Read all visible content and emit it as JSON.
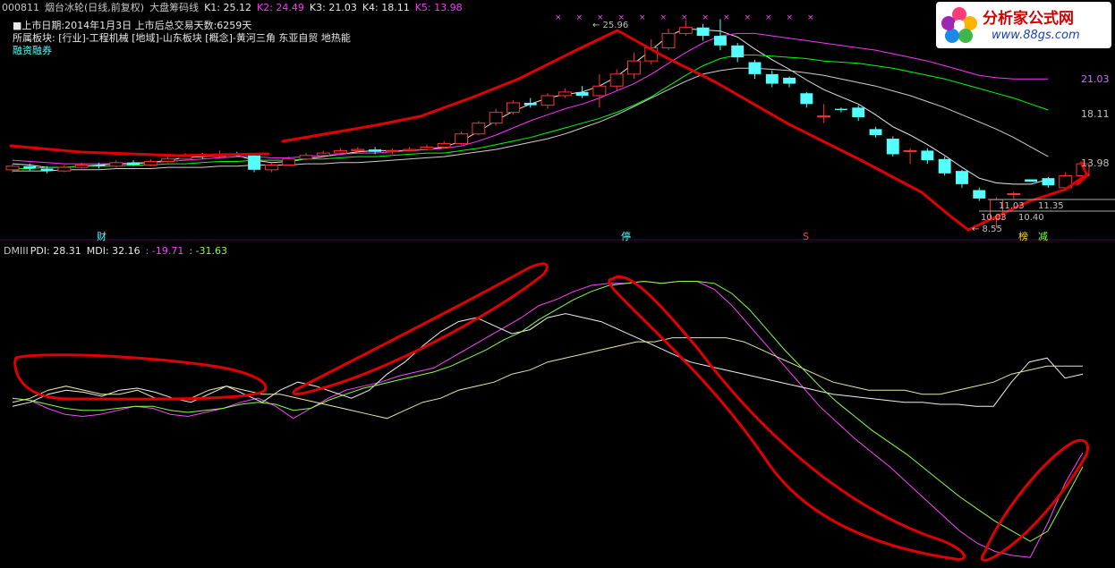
{
  "header": {
    "code": "000811",
    "name": "烟台冰轮(日线,前复权)",
    "indicator": "大盘筹码线",
    "k": [
      {
        "label": "K1: 25.12",
        "color": "#e8e8e8"
      },
      {
        "label": "K2: 24.49",
        "color": "#ff33ff"
      },
      {
        "label": "K3: 21.03",
        "color": "#e8e8e8"
      },
      {
        "label": "K4: 18.11",
        "color": "#e8e8e8"
      },
      {
        "label": "K5: 13.98",
        "color": "#ff33ff"
      }
    ],
    "list_date": "■上市日期:2014年1月3日 上市后总交易天数:6259天",
    "sectors": "所属板块: [行业]-工程机械 [地域]-山东板块 [概念]-黄河三角 东亚自贸 地热能",
    "margin": "融资融券"
  },
  "dmi_header": {
    "name": "DMIII",
    "pdi": "PDI: 28.31",
    "mdi": "MDI: 32.16",
    "v3": ": -19.71",
    "v4": ": -31.63"
  },
  "logo": {
    "title": "分析家公式网",
    "url": "www.88gs.com"
  },
  "colors": {
    "up": "#ff3232",
    "down": "#54ffff",
    "bg": "#000000",
    "annotation": "#e00000"
  },
  "chart_data": [
    {
      "type": "candlestick",
      "title": "烟台冰轮(日线,前复权)",
      "n_bars": 60,
      "candles": [
        {
          "o": 13.4,
          "c": 13.7,
          "h": 13.9,
          "l": 13.2
        },
        {
          "o": 13.7,
          "c": 13.5,
          "h": 13.9,
          "l": 13.3
        },
        {
          "o": 13.5,
          "c": 13.3,
          "h": 13.7,
          "l": 13.1
        },
        {
          "o": 13.3,
          "c": 13.6,
          "h": 13.8,
          "l": 13.2
        },
        {
          "o": 13.6,
          "c": 13.8,
          "h": 14.0,
          "l": 13.5
        },
        {
          "o": 13.8,
          "c": 13.7,
          "h": 14.0,
          "l": 13.5
        },
        {
          "o": 13.7,
          "c": 14.0,
          "h": 14.2,
          "l": 13.6
        },
        {
          "o": 14.0,
          "c": 13.8,
          "h": 14.2,
          "l": 13.7
        },
        {
          "o": 13.8,
          "c": 14.1,
          "h": 14.3,
          "l": 13.7
        },
        {
          "o": 14.1,
          "c": 14.3,
          "h": 14.5,
          "l": 14.0
        },
        {
          "o": 14.3,
          "c": 14.6,
          "h": 14.8,
          "l": 14.2
        },
        {
          "o": 14.6,
          "c": 14.5,
          "h": 14.8,
          "l": 14.3
        },
        {
          "o": 14.5,
          "c": 14.7,
          "h": 15.0,
          "l": 14.4
        },
        {
          "o": 14.7,
          "c": 14.6,
          "h": 14.9,
          "l": 14.5
        },
        {
          "o": 14.6,
          "c": 13.4,
          "h": 14.7,
          "l": 13.2
        },
        {
          "o": 13.4,
          "c": 13.8,
          "h": 14.0,
          "l": 13.2
        },
        {
          "o": 13.8,
          "c": 14.3,
          "h": 14.5,
          "l": 13.7
        },
        {
          "o": 14.3,
          "c": 14.6,
          "h": 14.8,
          "l": 14.2
        },
        {
          "o": 14.6,
          "c": 14.8,
          "h": 15.0,
          "l": 14.5
        },
        {
          "o": 14.8,
          "c": 15.0,
          "h": 15.2,
          "l": 14.6
        },
        {
          "o": 15.0,
          "c": 15.1,
          "h": 15.3,
          "l": 14.8
        },
        {
          "o": 15.1,
          "c": 14.9,
          "h": 15.3,
          "l": 14.7
        },
        {
          "o": 14.9,
          "c": 15.0,
          "h": 15.2,
          "l": 14.7
        },
        {
          "o": 15.0,
          "c": 15.1,
          "h": 15.3,
          "l": 14.9
        },
        {
          "o": 15.1,
          "c": 15.3,
          "h": 15.5,
          "l": 15.0
        },
        {
          "o": 15.3,
          "c": 15.6,
          "h": 15.8,
          "l": 15.2
        },
        {
          "o": 15.6,
          "c": 16.4,
          "h": 16.6,
          "l": 15.5
        },
        {
          "o": 16.4,
          "c": 17.3,
          "h": 17.5,
          "l": 16.3
        },
        {
          "o": 17.3,
          "c": 18.2,
          "h": 18.5,
          "l": 17.1
        },
        {
          "o": 18.2,
          "c": 19.0,
          "h": 19.2,
          "l": 18.0
        },
        {
          "o": 19.0,
          "c": 18.8,
          "h": 19.4,
          "l": 18.6
        },
        {
          "o": 18.8,
          "c": 19.6,
          "h": 19.8,
          "l": 18.5
        },
        {
          "o": 19.6,
          "c": 19.9,
          "h": 20.2,
          "l": 19.4
        },
        {
          "o": 19.9,
          "c": 19.6,
          "h": 20.4,
          "l": 19.4
        },
        {
          "o": 19.6,
          "c": 20.4,
          "h": 21.4,
          "l": 18.6
        },
        {
          "o": 20.4,
          "c": 21.4,
          "h": 21.8,
          "l": 20.0
        },
        {
          "o": 21.4,
          "c": 22.5,
          "h": 23.2,
          "l": 21.0
        },
        {
          "o": 22.5,
          "c": 23.6,
          "h": 24.3,
          "l": 22.2
        },
        {
          "o": 23.6,
          "c": 24.8,
          "h": 25.2,
          "l": 23.4
        },
        {
          "o": 24.8,
          "c": 25.3,
          "h": 25.9,
          "l": 24.6
        },
        {
          "o": 25.3,
          "c": 24.6,
          "h": 25.6,
          "l": 24.2
        },
        {
          "o": 24.6,
          "c": 23.8,
          "h": 26.0,
          "l": 23.4
        },
        {
          "o": 23.8,
          "c": 22.8,
          "h": 24.0,
          "l": 22.4
        },
        {
          "o": 22.4,
          "c": 21.4,
          "h": 22.6,
          "l": 21.0
        },
        {
          "o": 21.4,
          "c": 20.6,
          "h": 21.7,
          "l": 20.3
        },
        {
          "o": 21.1,
          "c": 20.6,
          "h": 21.2,
          "l": 20.3
        },
        {
          "o": 19.8,
          "c": 18.9,
          "h": 19.9,
          "l": 18.6
        },
        {
          "o": 17.9,
          "c": 17.9,
          "h": 18.9,
          "l": 17.3
        },
        {
          "o": 18.5,
          "c": 18.4,
          "h": 18.6,
          "l": 18.2
        },
        {
          "o": 18.6,
          "c": 17.8,
          "h": 18.8,
          "l": 17.5
        },
        {
          "o": 16.8,
          "c": 16.3,
          "h": 17.0,
          "l": 16.1
        },
        {
          "o": 16.0,
          "c": 14.7,
          "h": 16.2,
          "l": 14.5
        },
        {
          "o": 15.0,
          "c": 15.0,
          "h": 15.2,
          "l": 13.9
        },
        {
          "o": 15.0,
          "c": 14.2,
          "h": 15.2,
          "l": 13.9
        },
        {
          "o": 14.3,
          "c": 13.1,
          "h": 14.5,
          "l": 12.9
        },
        {
          "o": 13.3,
          "c": 12.2,
          "h": 13.4,
          "l": 11.9
        },
        {
          "o": 11.7,
          "c": 11.0,
          "h": 11.9,
          "l": 10.8
        },
        {
          "o": 9.3,
          "c": 10.9,
          "h": 11.1,
          "l": 8.55
        },
        {
          "o": 11.4,
          "c": 11.4,
          "h": 11.6,
          "l": 10.9
        },
        {
          "o": 12.6,
          "c": 12.4,
          "h": 12.6,
          "l": 12.4
        },
        {
          "o": 12.7,
          "c": 12.1,
          "h": 12.8,
          "l": 11.9
        },
        {
          "o": 11.9,
          "c": 12.9,
          "h": 13.2,
          "l": 11.8
        },
        {
          "o": 12.9,
          "c": 13.9,
          "h": 14.1,
          "l": 12.8
        }
      ],
      "series": [
        {
          "name": "K1",
          "color": "#e8e8e8",
          "values": [
            13.9,
            13.8,
            13.6,
            13.6,
            13.7,
            13.8,
            13.9,
            13.9,
            14.0,
            14.2,
            14.4,
            14.5,
            14.6,
            14.6,
            14.2,
            14.0,
            14.1,
            14.3,
            14.5,
            14.7,
            14.9,
            15.0,
            15.0,
            15.0,
            15.1,
            15.3,
            15.8,
            16.6,
            17.5,
            18.3,
            18.9,
            19.4,
            19.7,
            19.9,
            20.4,
            21.2,
            22.3,
            23.4,
            24.6,
            25.2,
            25.1,
            25.0,
            24.5,
            23.5,
            22.6,
            21.8,
            20.9,
            20.1,
            19.5,
            18.9,
            18.0,
            17.0,
            16.3,
            15.5,
            14.6,
            13.6,
            12.7,
            12.3,
            12.2,
            12.2,
            12.6
          ]
        },
        {
          "name": "K2",
          "color": "#ff33ff",
          "values": [
            14.2,
            14.1,
            14.0,
            13.9,
            13.9,
            13.9,
            13.9,
            14.0,
            14.0,
            14.1,
            14.2,
            14.3,
            14.4,
            14.5,
            14.5,
            14.4,
            14.4,
            14.5,
            14.6,
            14.7,
            14.8,
            14.8,
            14.9,
            15.0,
            15.1,
            15.2,
            15.4,
            15.8,
            16.3,
            16.9,
            17.5,
            18.0,
            18.5,
            18.9,
            19.4,
            20.0,
            20.6,
            21.4,
            22.3,
            23.2,
            24.0,
            24.6,
            24.8,
            24.8,
            24.6,
            24.4,
            24.2,
            24.0,
            23.8,
            23.6,
            23.4,
            23.1,
            22.8,
            22.5,
            22.1,
            21.7,
            21.3,
            21.1,
            21.0,
            21.0,
            21.0
          ]
        },
        {
          "name": "K3",
          "color": "#00ff00",
          "values": [
            13.5,
            13.5,
            13.6,
            13.6,
            13.7,
            13.7,
            13.7,
            13.8,
            13.8,
            13.9,
            13.9,
            14.0,
            14.1,
            14.1,
            14.2,
            14.2,
            14.2,
            14.3,
            14.3,
            14.4,
            14.5,
            14.5,
            14.6,
            14.7,
            14.8,
            14.8,
            15.0,
            15.2,
            15.5,
            15.8,
            16.1,
            16.5,
            16.9,
            17.3,
            17.7,
            18.2,
            18.8,
            19.5,
            20.4,
            21.3,
            22.1,
            22.7,
            23.0,
            23.0,
            22.9,
            22.8,
            22.7,
            22.5,
            22.4,
            22.3,
            22.1,
            21.9,
            21.6,
            21.3,
            21.0,
            20.6,
            20.2,
            19.8,
            19.4,
            18.9,
            18.4
          ]
        },
        {
          "name": "K4",
          "color": "#cfcfcf",
          "values": [
            13.3,
            13.3,
            13.3,
            13.4,
            13.4,
            13.4,
            13.5,
            13.5,
            13.5,
            13.6,
            13.6,
            13.6,
            13.7,
            13.7,
            13.8,
            13.8,
            13.8,
            13.9,
            13.9,
            14.0,
            14.0,
            14.1,
            14.2,
            14.3,
            14.4,
            14.5,
            14.7,
            14.9,
            15.1,
            15.4,
            15.7,
            16.0,
            16.4,
            16.9,
            17.4,
            18.0,
            18.7,
            19.4,
            20.1,
            20.8,
            21.4,
            21.7,
            21.9,
            21.9,
            21.8,
            21.7,
            21.5,
            21.3,
            21.0,
            20.7,
            20.4,
            20.0,
            19.6,
            19.1,
            18.6,
            18.0,
            17.4,
            16.8,
            16.1,
            15.3,
            14.5
          ]
        }
      ],
      "ylim": [
        8.0,
        27.0
      ],
      "price_labels": [
        "25.96",
        "21.03",
        "18.11",
        "13.98",
        "11.03",
        "11.35",
        "10.03",
        "10.40",
        "8.55"
      ],
      "markers": [
        "财",
        "停",
        "S",
        "榜",
        "减"
      ]
    },
    {
      "type": "line",
      "title": "DMIII",
      "n_points": 60,
      "series": [
        {
          "name": "PDI",
          "color": "#ff44ff",
          "values": [
            22,
            21,
            17,
            14,
            13,
            14,
            16,
            18,
            17,
            14,
            13,
            15,
            17,
            20,
            22,
            18,
            12,
            17,
            22,
            26,
            28,
            30,
            33,
            35,
            37,
            42,
            47,
            52,
            57,
            62,
            68,
            71,
            75,
            78,
            79,
            79,
            80,
            79,
            80,
            80,
            76,
            68,
            58,
            48,
            38,
            28,
            18,
            10,
            2,
            -5,
            -12,
            -20,
            -28,
            -36,
            -44,
            -50,
            -54,
            -56,
            -57,
            -40,
            -20,
            -5
          ]
        },
        {
          "name": "MDI",
          "color": "#f0f0f0",
          "values": [
            18,
            20,
            24,
            26,
            25,
            23,
            26,
            27,
            25,
            22,
            20,
            24,
            28,
            24,
            20,
            26,
            30,
            28,
            25,
            22,
            26,
            34,
            40,
            48,
            55,
            60,
            62,
            58,
            54,
            56,
            62,
            64,
            62,
            60,
            56,
            52,
            48,
            44,
            40,
            38,
            36,
            34,
            32,
            30,
            28,
            26,
            24,
            23,
            22,
            21,
            20,
            20,
            19,
            19,
            18,
            18,
            30,
            40,
            42,
            32,
            34
          ]
        },
        {
          "name": "PDI-MDI",
          "color": "#e8e8a8",
          "values": [
            20,
            22,
            26,
            28,
            26,
            24,
            24,
            26,
            22,
            22,
            22,
            26,
            28,
            26,
            24,
            24,
            22,
            20,
            18,
            16,
            14,
            12,
            16,
            20,
            22,
            26,
            28,
            30,
            34,
            36,
            40,
            42,
            44,
            46,
            48,
            50,
            50,
            52,
            52,
            52,
            52,
            50,
            46,
            42,
            38,
            34,
            30,
            28,
            26,
            26,
            26,
            24,
            24,
            26,
            28,
            30,
            34,
            36,
            38,
            38,
            38
          ]
        },
        {
          "name": "ADX",
          "color": "#88ff44",
          "values": [
            22,
            21,
            19,
            17,
            16,
            16,
            17,
            18,
            18,
            16,
            15,
            16,
            17,
            19,
            20,
            19,
            16,
            17,
            21,
            24,
            27,
            29,
            31,
            33,
            35,
            38,
            42,
            46,
            51,
            55,
            61,
            66,
            71,
            75,
            78,
            79,
            80,
            79,
            80,
            80,
            79,
            74,
            66,
            56,
            46,
            37,
            28,
            20,
            13,
            6,
            0,
            -6,
            -13,
            -20,
            -27,
            -33,
            -39,
            -44,
            -49,
            -44,
            -28,
            -12
          ]
        }
      ],
      "ylim": [
        -60,
        90
      ]
    }
  ]
}
